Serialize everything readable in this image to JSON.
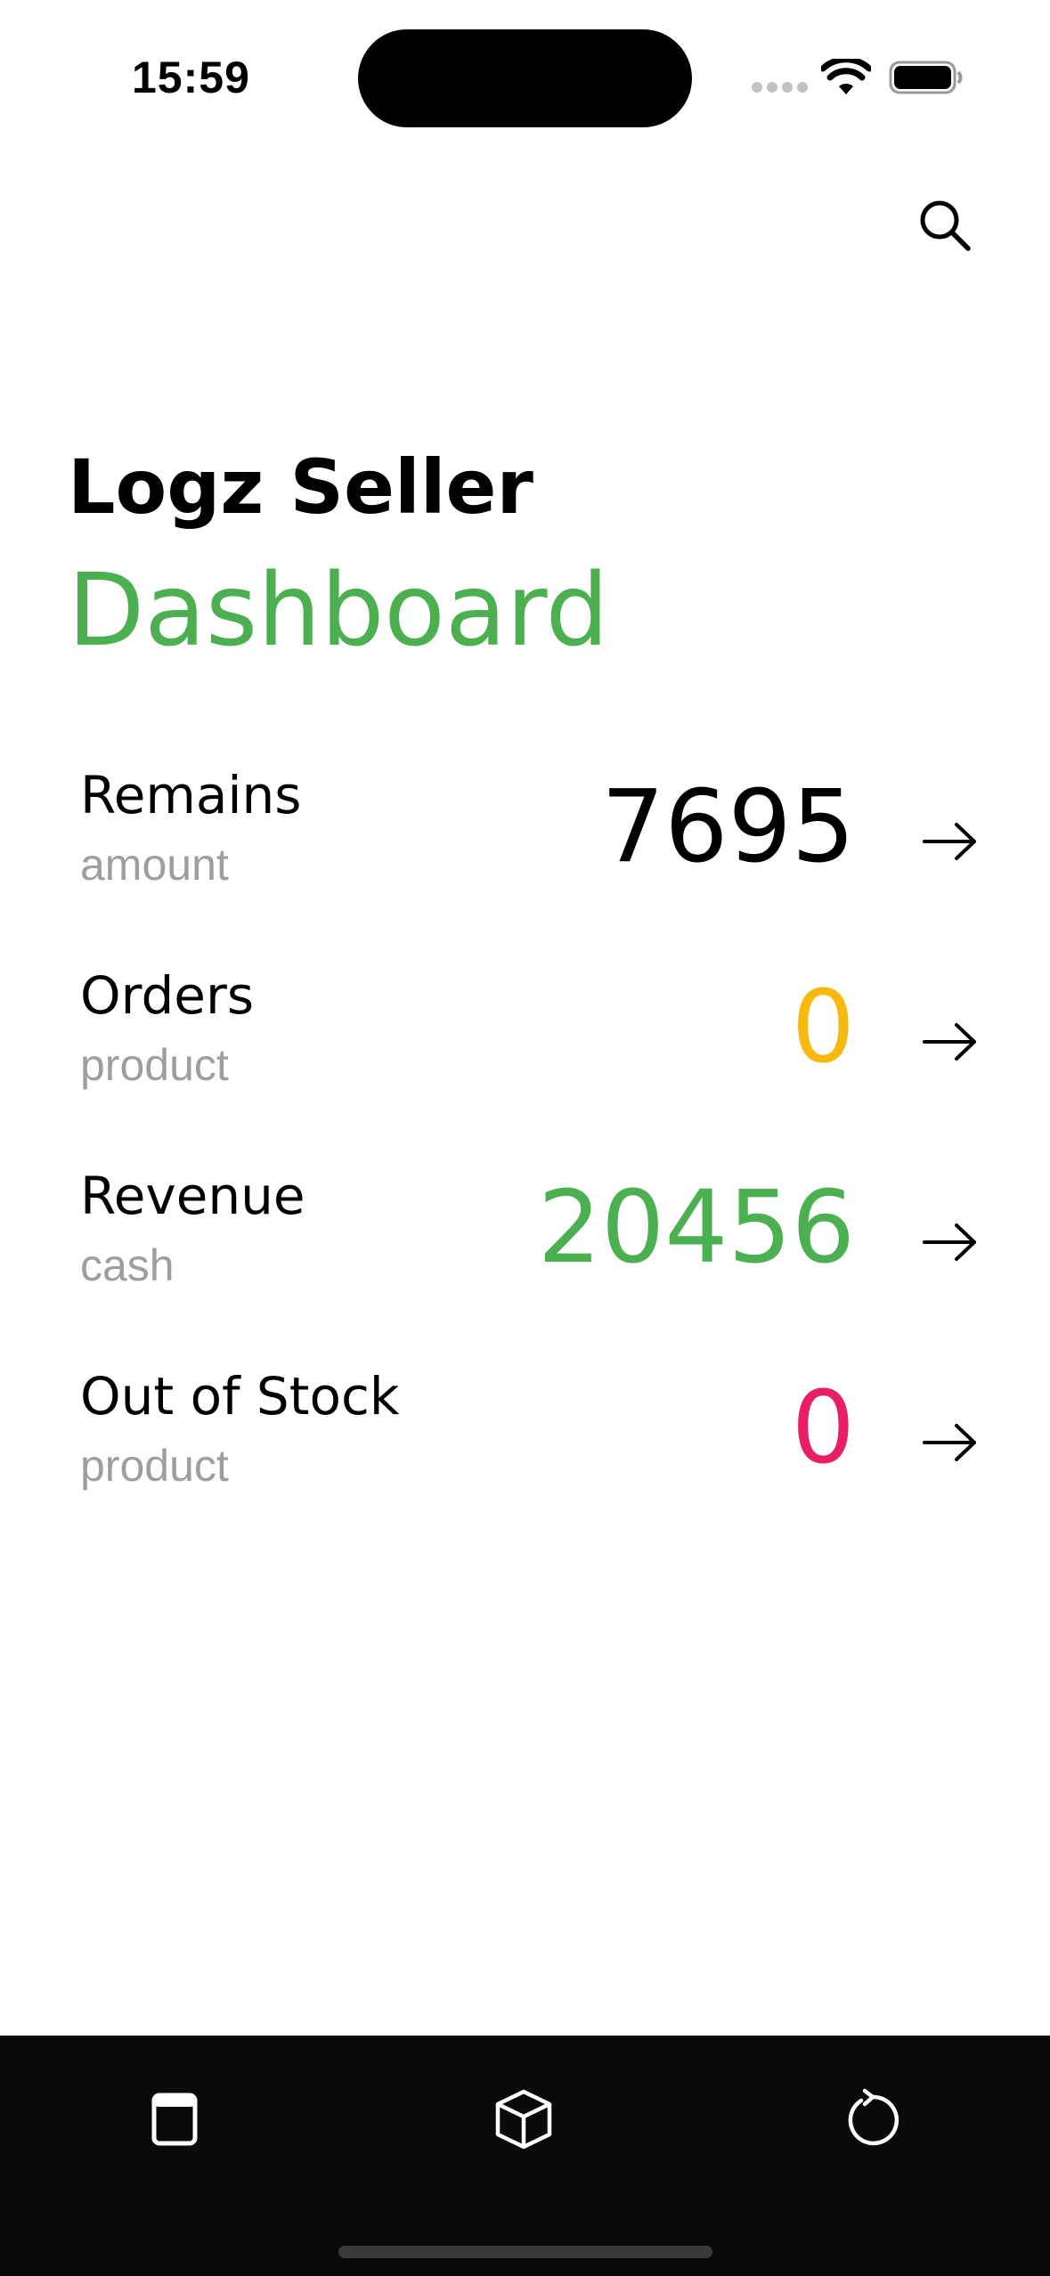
{
  "status_bar": {
    "time": "15:59",
    "icons": [
      "cellular-dots-icon",
      "wifi-icon",
      "battery-icon"
    ]
  },
  "header": {
    "search_icon": "search-icon"
  },
  "titles": {
    "app_name": "Logz Seller",
    "page_name": "Dashboard"
  },
  "metrics": [
    {
      "label": "Remains",
      "sub": "amount",
      "value": "7695",
      "color": "#000000"
    },
    {
      "label": "Orders",
      "sub": "product",
      "value": "0",
      "color": "#f5b90f"
    },
    {
      "label": "Revenue",
      "sub": "cash",
      "value": "20456",
      "color": "#4caf50"
    },
    {
      "label": "Out of Stock",
      "sub": "product",
      "value": "0",
      "color": "#e91e63"
    }
  ],
  "colors": {
    "accent_green": "#4caf50",
    "warning_yellow": "#f5b90f",
    "alert_pink": "#e91e63",
    "subtext_gray": "#9e9e9e",
    "tab_bar_bg": "#0a0a0a"
  },
  "tab_bar": {
    "items": [
      "document-icon",
      "box-icon",
      "refresh-icon"
    ]
  }
}
